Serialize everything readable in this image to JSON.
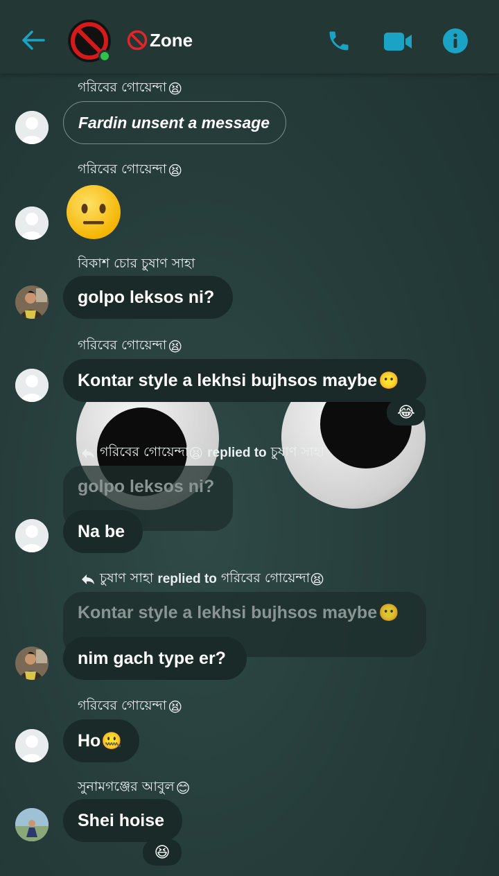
{
  "header": {
    "title": "Zone",
    "colors": {
      "accent": "#1aa3c4",
      "online": "#31c24d"
    },
    "icons": [
      "back-arrow-icon",
      "phone-icon",
      "video-icon",
      "info-icon"
    ]
  },
  "messages": {
    "m1": {
      "sender": "গরিবের গোয়েন্দা",
      "text": "Fardin unsent a message"
    },
    "m2": {
      "sender": "গরিবের গোয়েন্দা"
    },
    "m3": {
      "sender": "বিকাশ চোর চুষাণ সাহা",
      "text": "golpo leksos ni?"
    },
    "m4": {
      "sender": "গরিবের গোয়েন্দা",
      "text": "Kontar style a lekhsi bujhsos maybe"
    },
    "m5": {
      "reply_from": "গরিবের গোয়েন্দা",
      "reply_mid": "replied to",
      "reply_to": "চুষাণ সাহা",
      "quoted": "golpo leksos ni?",
      "text": "Na be"
    },
    "m6": {
      "reply_from": "চুষাণ সাহা",
      "reply_mid": "replied to",
      "reply_to": "গরিবের গোয়েন্দা",
      "quoted": "Kontar style a lekhsi bujhsos maybe",
      "text": "nim gach type er?"
    },
    "m7": {
      "sender": "গরিবের গোয়েন্দা",
      "text": "Ho"
    },
    "m8": {
      "sender": "সুনামগঞ্জের আবুল",
      "text": "Shei hoise"
    }
  }
}
